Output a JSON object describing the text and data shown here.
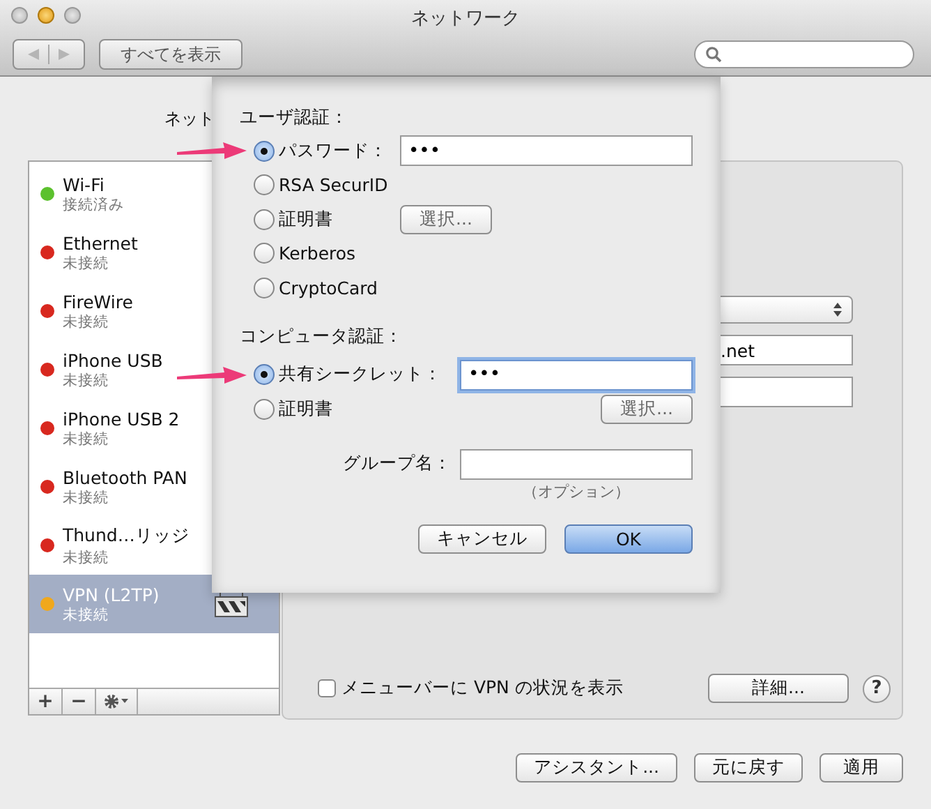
{
  "window": {
    "title": "ネットワーク"
  },
  "toolbar": {
    "show_all": "すべてを表示"
  },
  "location_label": "ネット",
  "services": [
    {
      "name": "Wi-Fi",
      "status": "接続済み",
      "color": "#5cc12e",
      "selected": false,
      "kind": "plain"
    },
    {
      "name": "Ethernet",
      "status": "未接続",
      "color": "#d8281f",
      "selected": false,
      "kind": "plain"
    },
    {
      "name": "FireWire",
      "status": "未接続",
      "color": "#d8281f",
      "selected": false,
      "kind": "plain"
    },
    {
      "name": "iPhone USB",
      "status": "未接続",
      "color": "#d8281f",
      "selected": false,
      "kind": "plain"
    },
    {
      "name": "iPhone USB 2",
      "status": "未接続",
      "color": "#d8281f",
      "selected": false,
      "kind": "plain"
    },
    {
      "name": "Bluetooth PAN",
      "status": "未接続",
      "color": "#d8281f",
      "selected": false,
      "kind": "plain"
    },
    {
      "name": "Thund…リッジ",
      "status": "未接続",
      "color": "#d8281f",
      "selected": false,
      "kind": "plain"
    },
    {
      "name": "VPN (L2TP)",
      "status": "未接続",
      "color": "#f0a81c",
      "selected": true,
      "kind": "vpn"
    }
  ],
  "sidebar_buttons": [
    "+",
    "−"
  ],
  "panel": {
    "server_value": ".net",
    "menubar_checkbox": {
      "label": "メニューバーに VPN の状況を表示",
      "checked": false
    },
    "advanced_button": "詳細...",
    "help_button": "?"
  },
  "footer_buttons": [
    "アシスタント...",
    "元に戻す",
    "適用"
  ],
  "sheet": {
    "sections": [
      {
        "label": "ユーザ認証：",
        "options": [
          {
            "label": "パスワード：",
            "selected": true,
            "kind": "field",
            "value": "•••",
            "focused": false
          },
          {
            "label": "RSA SecurID",
            "selected": false,
            "kind": "plain"
          },
          {
            "label": "証明書",
            "selected": false,
            "kind": "button",
            "button": "選択..."
          },
          {
            "label": "Kerberos",
            "selected": false,
            "kind": "plain"
          },
          {
            "label": "CryptoCard",
            "selected": false,
            "kind": "plain"
          }
        ]
      },
      {
        "label": "コンピュータ認証：",
        "options": [
          {
            "label": "共有シークレット：",
            "selected": true,
            "kind": "field",
            "value": "•••",
            "focused": true
          },
          {
            "label": "証明書",
            "selected": false,
            "kind": "button",
            "button": "選択..."
          }
        ]
      }
    ],
    "group": {
      "label": "グループ名：",
      "hint": "（オプション）"
    },
    "buttons": [
      {
        "label": "キャンセル",
        "default": false
      },
      {
        "label": "OK",
        "default": true
      }
    ]
  }
}
